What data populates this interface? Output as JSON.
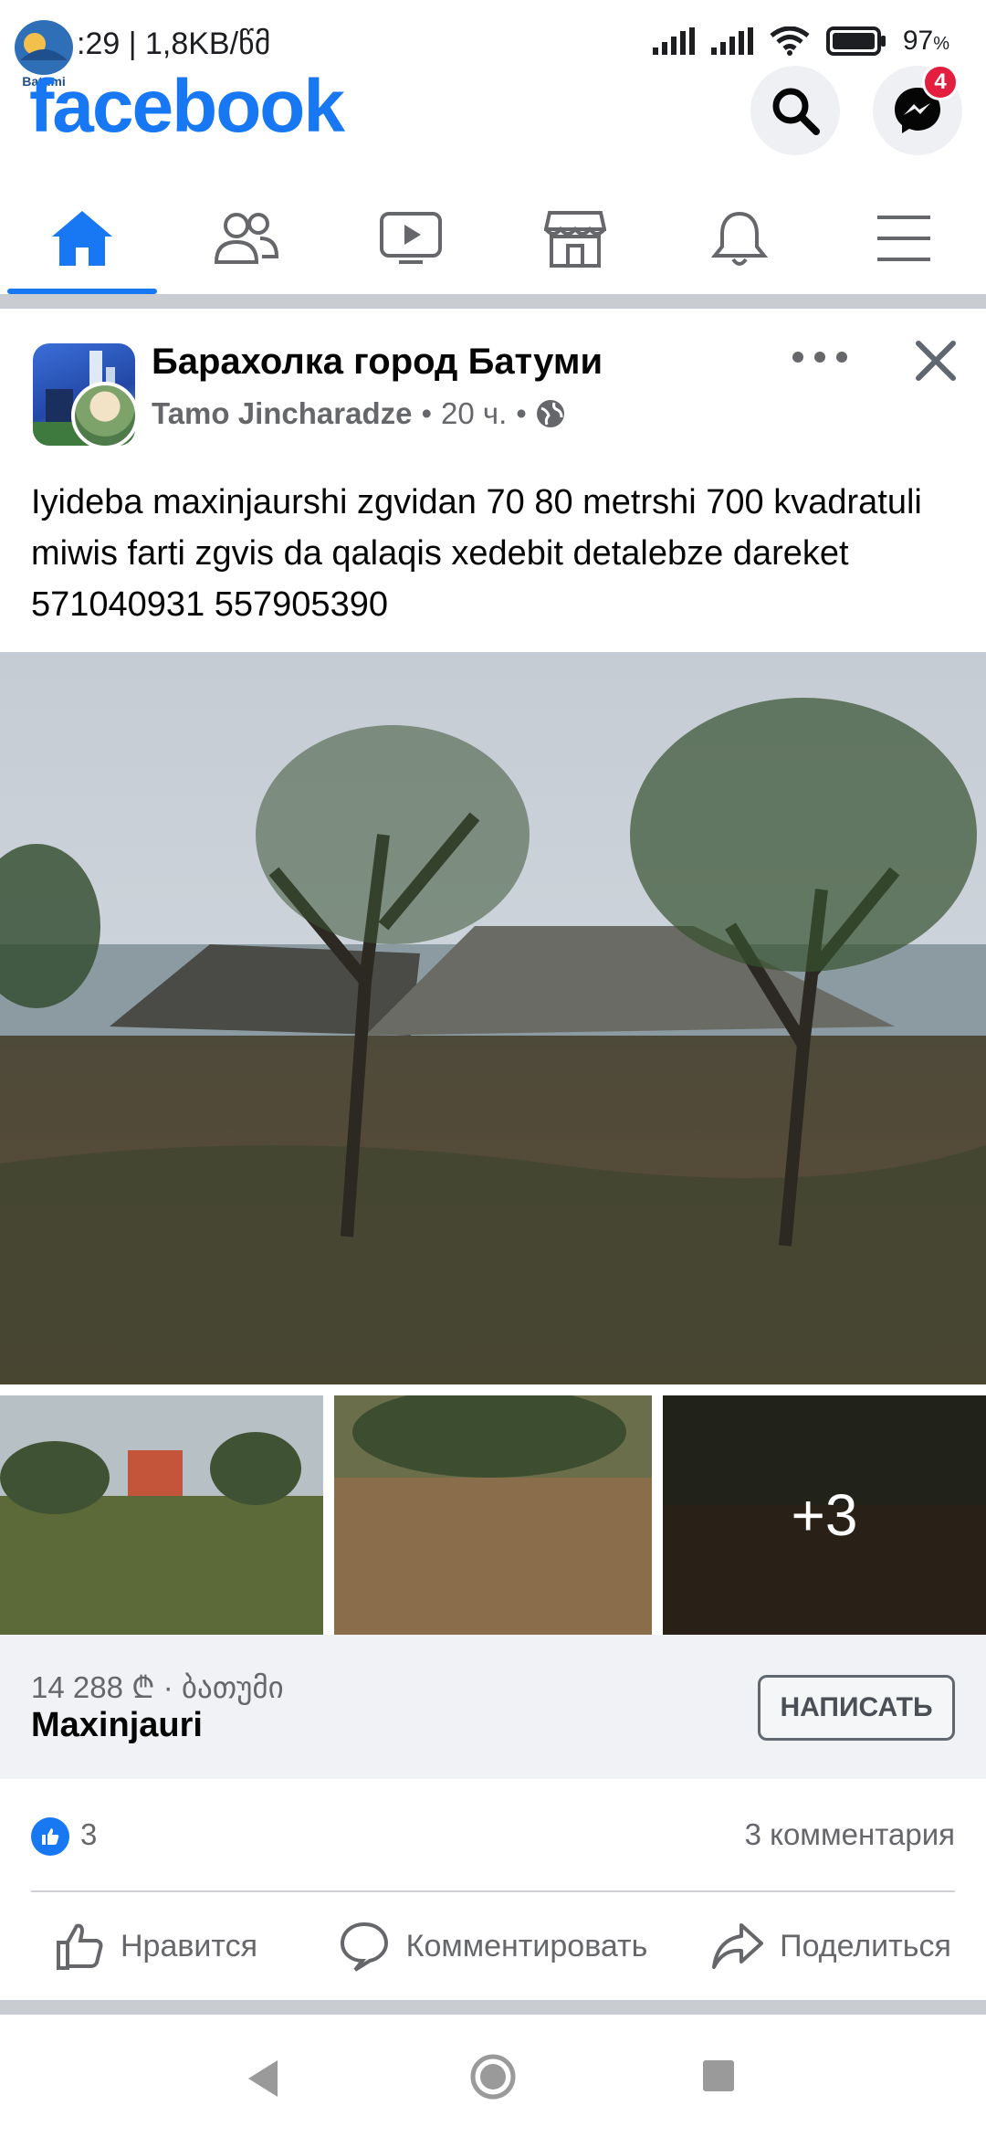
{
  "status_bar": {
    "time_network": ":29 | 1,8KB/წმ",
    "battery": "97",
    "battery_unit": "%"
  },
  "corner_logo_text": "Batumi",
  "header": {
    "logo": "facebook",
    "messenger_badge": "4",
    "icons": [
      "search-icon",
      "messenger-icon"
    ]
  },
  "tabs": [
    {
      "name": "home",
      "icon": "home-icon",
      "active": true
    },
    {
      "name": "friends",
      "icon": "friends-icon",
      "active": false
    },
    {
      "name": "watch",
      "icon": "video-icon",
      "active": false
    },
    {
      "name": "marketplace",
      "icon": "store-icon",
      "active": false
    },
    {
      "name": "notifications",
      "icon": "bell-icon",
      "active": false
    },
    {
      "name": "menu",
      "icon": "menu-icon",
      "active": false
    }
  ],
  "post": {
    "group_name": "Барахолка город Батуми",
    "author": "Tamo Jincharadze",
    "time": "20 ч.",
    "sep": "•",
    "text": "Iyideba maxinjaurshi zgvidan 70 80 metrshi 700 kvadratuli miwis farti zgvis da qalaqis xedebit detalebze dareket 571040931 557905390",
    "more_photos": "+3"
  },
  "listing": {
    "price_location": "14 288 ₾ · ბათუმი",
    "title": "Maxinjauri",
    "write_button": "НАПИСАТЬ"
  },
  "reactions": {
    "like_count": "3",
    "comments": "3 комментария"
  },
  "actions": {
    "like": "Нравится",
    "comment": "Комментировать",
    "share": "Поделиться"
  },
  "colors": {
    "brand": "#1877f2",
    "badge": "#e41e3f",
    "secondary_text": "#65676b"
  }
}
